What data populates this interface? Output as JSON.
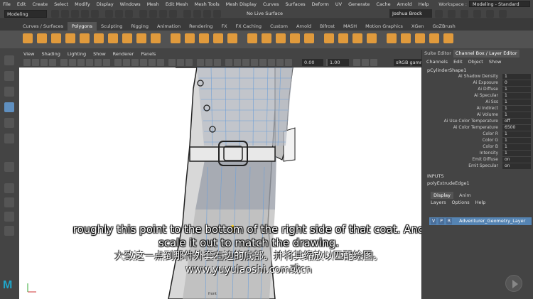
{
  "menubar": {
    "items": [
      "File",
      "Edit",
      "Create",
      "Select",
      "Modify",
      "Display",
      "Windows",
      "Mesh",
      "Edit Mesh",
      "Mesh Tools",
      "Mesh Display",
      "Curves",
      "Surfaces",
      "Deform",
      "UV",
      "Generate",
      "Cache",
      "Arnold",
      "Help"
    ],
    "workspace_label": "Workspace :",
    "workspace_value": "Modeling - Standard"
  },
  "statusline": {
    "mode": "Modeling",
    "live_surface": "No Live Surface",
    "user": "Joshua Brock"
  },
  "shelf": {
    "tabs": [
      "Curves / Surfaces",
      "Polygons",
      "Sculpting",
      "Rigging",
      "Animation",
      "Rendering",
      "FX",
      "FX Caching",
      "Custom",
      "Arnold",
      "Bifrost",
      "MASH",
      "Motion Graphics",
      "XGen",
      "GoZBrush"
    ],
    "active_tab": 1
  },
  "panel": {
    "menu": [
      "View",
      "Shading",
      "Lighting",
      "Show",
      "Renderer",
      "Panels"
    ],
    "near_value": "0.00",
    "far_value": "1.00",
    "color_space": "sRGB gamma",
    "camera_label": "front"
  },
  "channel_box": {
    "tabs": [
      "Suite Editor",
      "Channel Box / Layer Editor"
    ],
    "menu": [
      "Channels",
      "Edit",
      "Object",
      "Show"
    ],
    "shape_name": "pCylinderShape1",
    "attributes": [
      {
        "label": "Ai Shadow Density",
        "value": "1"
      },
      {
        "label": "Ai Exposure",
        "value": "0"
      },
      {
        "label": "Ai Diffuse",
        "value": "1"
      },
      {
        "label": "Ai Specular",
        "value": "1"
      },
      {
        "label": "Ai Sss",
        "value": "1"
      },
      {
        "label": "Ai Indirect",
        "value": "1"
      },
      {
        "label": "Ai Volume",
        "value": "1"
      },
      {
        "label": "Ai Use Color Temperature",
        "value": "off"
      },
      {
        "label": "Ai Color Temperature",
        "value": "6500"
      },
      {
        "label": "Color R",
        "value": "1"
      },
      {
        "label": "Color G",
        "value": "1"
      },
      {
        "label": "Color B",
        "value": "1"
      },
      {
        "label": "Intensity",
        "value": "1"
      },
      {
        "label": "Emit Diffuse",
        "value": "on"
      },
      {
        "label": "Emit Specular",
        "value": "on"
      }
    ],
    "inputs_header": "INPUTS",
    "input_node": "polyExtrudeEdge1"
  },
  "layer_editor": {
    "tabs": [
      "Display",
      "Anim"
    ],
    "menu": [
      "Layers",
      "Options",
      "Help"
    ],
    "layer": {
      "v": "V",
      "p": "P",
      "r": "R",
      "name": "Adventurer_Geometry_Layer"
    }
  },
  "subtitles": {
    "english": "roughly this point to the bottom of the right side of that coat. And scale it out to match the drawing.",
    "chinese": "大致这一点到那件外套右边的底部。并将其缩放以匹配绘图。",
    "url": "www.yuyulaoshi.com或cn"
  },
  "colors": {
    "accent_blue": "#5584b3",
    "shelf_orange": "#e09a3c",
    "maya_logo": "#20a5c8"
  }
}
